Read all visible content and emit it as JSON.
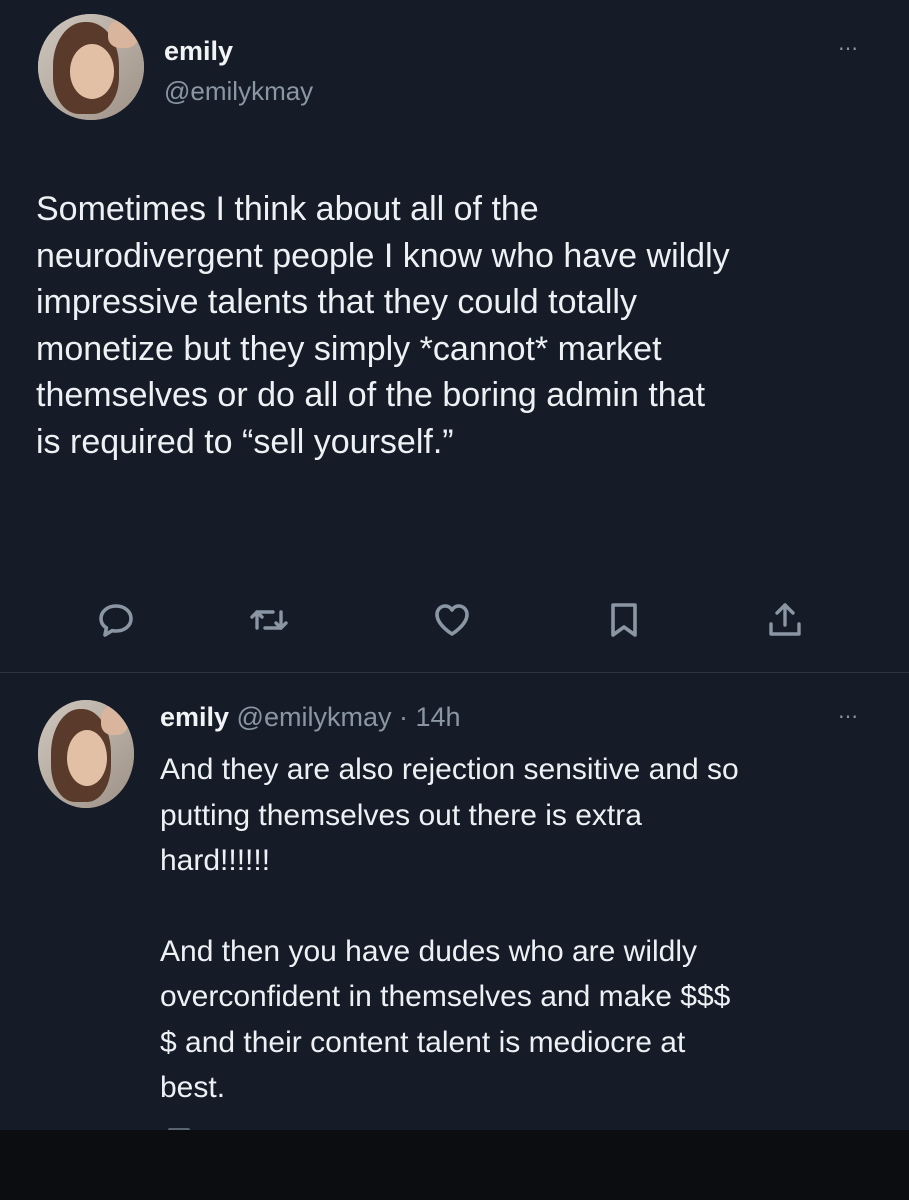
{
  "main_tweet": {
    "author_name": "emily",
    "author_handle": "@emilykmay",
    "more_icon": "⋯",
    "text": "Sometimes I think about all of the\nneurodivergent people I know who have wildly\nimpressive talents that they could totally\nmonetize but they simply *cannot* market\nthemselves or do all of the boring admin that\nis required to “sell yourself.”",
    "actions": [
      "reply-icon",
      "retweet-icon",
      "like-icon",
      "bookmark-icon",
      "share-icon"
    ]
  },
  "reply_tweet": {
    "author_name": "emily",
    "meta": " @emilykmay · 14h",
    "more_icon": "⋯",
    "paragraphs": [
      "And they are also rejection sensitive and so\nputting themselves out there is extra\nhard!!!!!!",
      "And then you have dudes who are wildly\noverconfident in themselves and make $$$\n$ and their content talent is mediocre at\nbest."
    ]
  },
  "colors": {
    "background": "#151c28",
    "text": "#eef1f4",
    "secondary_text": "#8a96a3",
    "divider": "#2c3440"
  }
}
